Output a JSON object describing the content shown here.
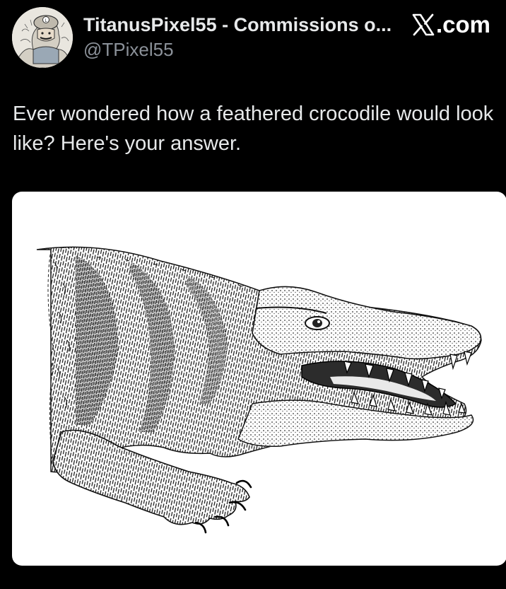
{
  "tweet": {
    "author": {
      "display_name": "TitanusPixel55 - Commissions o...",
      "handle": "@TPixel55",
      "avatar_icon": "character-avatar-icon"
    },
    "brand": {
      "logo_icon": "x-logo-icon",
      "label": ".com"
    },
    "text": "Ever wondered how a feathered crocodile would look like? Here's your answer.",
    "media": {
      "icon": "feathered-crocodile-illustration"
    }
  },
  "colors": {
    "background": "#000000",
    "text_primary": "#e7e9ea",
    "text_secondary": "#8b9199",
    "media_background": "#ffffff"
  }
}
